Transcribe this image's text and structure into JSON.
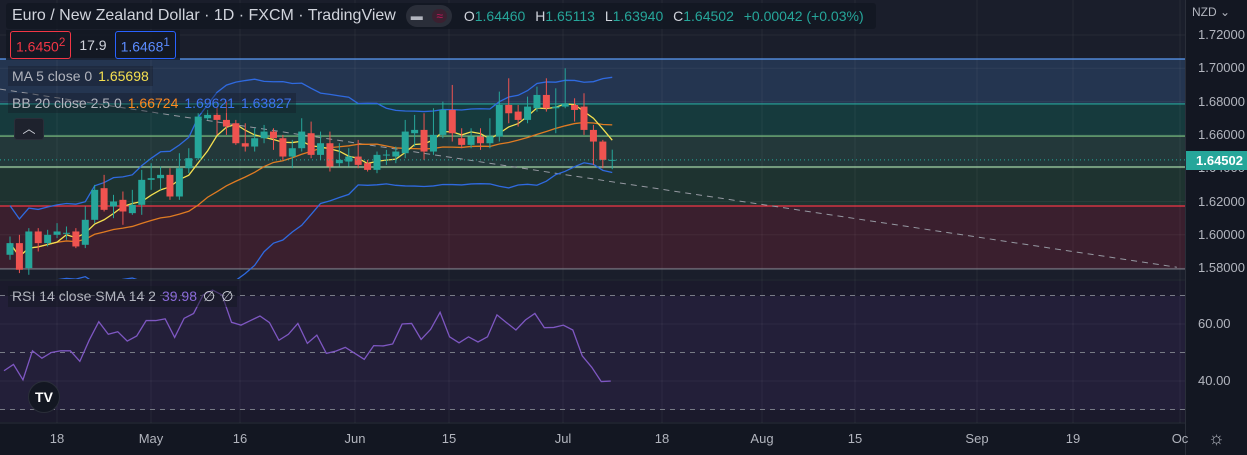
{
  "header": {
    "title": "Euro / New Zealand Dollar · 1D · FXCM · TradingView",
    "o_label": "O",
    "o": "1.64460",
    "h_label": "H",
    "h": "1.65113",
    "l_label": "L",
    "l": "1.63940",
    "c_label": "C",
    "c": "1.64502",
    "change": "+0.00042 (+0.03%)"
  },
  "quote": {
    "sell": "1.6450",
    "sell_sup": "2",
    "spread": "17.9",
    "buy": "1.6468",
    "buy_sup": "1"
  },
  "legend": {
    "ma": {
      "name": "MA 5 close 0",
      "value": "1.65698",
      "color": "#f5e050"
    },
    "bb": {
      "name": "BB 20 close 2.5 0",
      "basis": "1.66724",
      "upper": "1.69621",
      "lower": "1.63827",
      "basis_color": "#ff8a1f",
      "band_color": "#2f6ae0"
    },
    "rsi": {
      "name": "RSI 14 close SMA 14 2",
      "value": "39.98",
      "extra1": "∅",
      "extra2": "∅",
      "color": "#7e57c2"
    }
  },
  "collapse_icon": "chevron-up-icon",
  "price_axis": {
    "currency": "NZD ⌄",
    "ticks": [
      "1.72000",
      "1.70000",
      "1.68000",
      "1.66000",
      "1.64000",
      "1.62000",
      "1.60000",
      "1.58000"
    ],
    "last_price": "1.64502",
    "last_price_color": "#26a69a"
  },
  "rsi_axis": {
    "ticks": [
      "60.00",
      "40.00"
    ]
  },
  "time_axis": [
    "18",
    "May",
    "16",
    "Jun",
    "15",
    "Jul",
    "18",
    "Aug",
    "15",
    "Sep",
    "19",
    "Oc"
  ],
  "settings_icon": "gear-icon",
  "logo": "TV",
  "chart_data": {
    "type": "candlestick",
    "symbol": "EURNZD",
    "interval": "1D",
    "ylim": [
      1.57,
      1.725
    ],
    "up_color": "#26a69a",
    "down_color": "#ef5350",
    "bars": [
      [
        1.588,
        1.599,
        1.585,
        1.595
      ],
      [
        1.595,
        1.6,
        1.577,
        1.579
      ],
      [
        1.58,
        1.604,
        1.576,
        1.602
      ],
      [
        1.602,
        1.604,
        1.59,
        1.595
      ],
      [
        1.595,
        1.603,
        1.593,
        1.6
      ],
      [
        1.6,
        1.607,
        1.598,
        1.602
      ],
      [
        1.601,
        1.605,
        1.597,
        1.6012
      ],
      [
        1.602,
        1.604,
        1.592,
        1.593
      ],
      [
        1.594,
        1.617,
        1.592,
        1.609
      ],
      [
        1.609,
        1.63,
        1.607,
        1.627
      ],
      [
        1.628,
        1.636,
        1.614,
        1.615
      ],
      [
        1.617,
        1.624,
        1.61,
        1.62
      ],
      [
        1.621,
        1.626,
        1.606,
        1.614
      ],
      [
        1.613,
        1.627,
        1.612,
        1.618
      ],
      [
        1.618,
        1.639,
        1.612,
        1.633
      ],
      [
        1.633,
        1.643,
        1.627,
        1.634
      ],
      [
        1.634,
        1.641,
        1.627,
        1.636
      ],
      [
        1.636,
        1.64,
        1.621,
        1.623
      ],
      [
        1.623,
        1.649,
        1.621,
        1.64
      ],
      [
        1.64,
        1.652,
        1.637,
        1.646
      ],
      [
        1.646,
        1.673,
        1.645,
        1.671
      ],
      [
        1.67,
        1.675,
        1.669,
        1.672
      ],
      [
        1.672,
        1.677,
        1.66,
        1.669
      ],
      [
        1.669,
        1.68,
        1.66,
        1.665
      ],
      [
        1.667,
        1.669,
        1.654,
        1.655
      ],
      [
        1.655,
        1.667,
        1.65,
        1.653
      ],
      [
        1.653,
        1.664,
        1.65,
        1.658
      ],
      [
        1.658,
        1.666,
        1.655,
        1.662
      ],
      [
        1.662,
        1.664,
        1.651,
        1.658
      ],
      [
        1.658,
        1.66,
        1.645,
        1.647
      ],
      [
        1.647,
        1.657,
        1.64,
        1.652
      ],
      [
        1.652,
        1.67,
        1.65,
        1.662
      ],
      [
        1.661,
        1.668,
        1.646,
        1.648
      ],
      [
        1.648,
        1.662,
        1.645,
        1.655
      ],
      [
        1.655,
        1.662,
        1.638,
        1.641
      ],
      [
        1.643,
        1.655,
        1.641,
        1.645
      ],
      [
        1.644,
        1.652,
        1.641,
        1.647
      ],
      [
        1.647,
        1.657,
        1.64,
        1.642
      ],
      [
        1.643,
        1.645,
        1.638,
        1.639
      ],
      [
        1.639,
        1.65,
        1.637,
        1.648
      ],
      [
        1.648,
        1.651,
        1.642,
        1.6482
      ],
      [
        1.647,
        1.653,
        1.643,
        1.65
      ],
      [
        1.649,
        1.669,
        1.646,
        1.662
      ],
      [
        1.661,
        1.672,
        1.653,
        1.663
      ],
      [
        1.663,
        1.673,
        1.645,
        1.65
      ],
      [
        1.65,
        1.676,
        1.648,
        1.66
      ],
      [
        1.66,
        1.68,
        1.658,
        1.675
      ],
      [
        1.675,
        1.69,
        1.656,
        1.661
      ],
      [
        1.658,
        1.664,
        1.652,
        1.654
      ],
      [
        1.654,
        1.664,
        1.652,
        1.659
      ],
      [
        1.659,
        1.664,
        1.651,
        1.655
      ],
      [
        1.655,
        1.67,
        1.652,
        1.659
      ],
      [
        1.659,
        1.686,
        1.656,
        1.678
      ],
      [
        1.678,
        1.694,
        1.667,
        1.673
      ],
      [
        1.674,
        1.678,
        1.665,
        1.669
      ],
      [
        1.669,
        1.683,
        1.667,
        1.677
      ],
      [
        1.676,
        1.689,
        1.674,
        1.684
      ],
      [
        1.684,
        1.694,
        1.674,
        1.676
      ],
      [
        1.676,
        1.688,
        1.661,
        1.677
      ],
      [
        1.677,
        1.7,
        1.676,
        1.679
      ],
      [
        1.678,
        1.682,
        1.668,
        1.675
      ],
      [
        1.677,
        1.685,
        1.66,
        1.663
      ],
      [
        1.663,
        1.666,
        1.642,
        1.656
      ],
      [
        1.656,
        1.657,
        1.64,
        1.645
      ],
      [
        1.6446,
        1.65113,
        1.6394,
        1.64502
      ]
    ],
    "rsi": [
      43.6,
      45.8,
      40.4,
      50.6,
      48,
      50,
      50.6,
      50.6,
      46.9,
      54.4,
      60.8,
      56.4,
      57.3,
      54,
      55.8,
      61.2,
      61.2,
      61.8,
      55.3,
      62,
      63.7,
      70.2,
      71.9,
      70.2,
      60.6,
      59.6,
      61.2,
      62.8,
      60.5,
      54.3,
      56.4,
      60.2,
      53.2,
      56.1,
      49.7,
      50.5,
      51.8,
      49.7,
      47.6,
      52.4,
      52.3,
      53,
      60,
      60.2,
      54.6,
      58.1,
      64.1,
      55.5,
      53.4,
      55.5,
      53.7,
      55.5,
      63.2,
      60.5,
      57.9,
      61.4,
      63.7,
      58.7,
      58.8,
      59.6,
      57.9,
      48.8,
      44.8,
      39.8,
      39.98
    ],
    "rsi_levels": [
      70,
      50,
      30
    ],
    "horizontal_levels": [
      {
        "price": 1.7056,
        "color": "#5b9cf6"
      },
      {
        "price": 1.6786,
        "color": "#26a69a"
      },
      {
        "price": 1.6593,
        "color": "#81c784"
      },
      {
        "price": 1.6407,
        "color": "#a5d6a7"
      },
      {
        "price": 1.6173,
        "color": "#f23645"
      },
      {
        "price": 1.5795,
        "color": "#787b86"
      }
    ],
    "zone_fills": [
      "#243550",
      "#163a3d",
      "#23383a",
      "#1e3330",
      "#3a1f2e"
    ],
    "trendline": {
      "start": {
        "bar": 0,
        "price": 1.6875
      },
      "end": {
        "bar": 124,
        "price": 1.5805
      }
    }
  }
}
